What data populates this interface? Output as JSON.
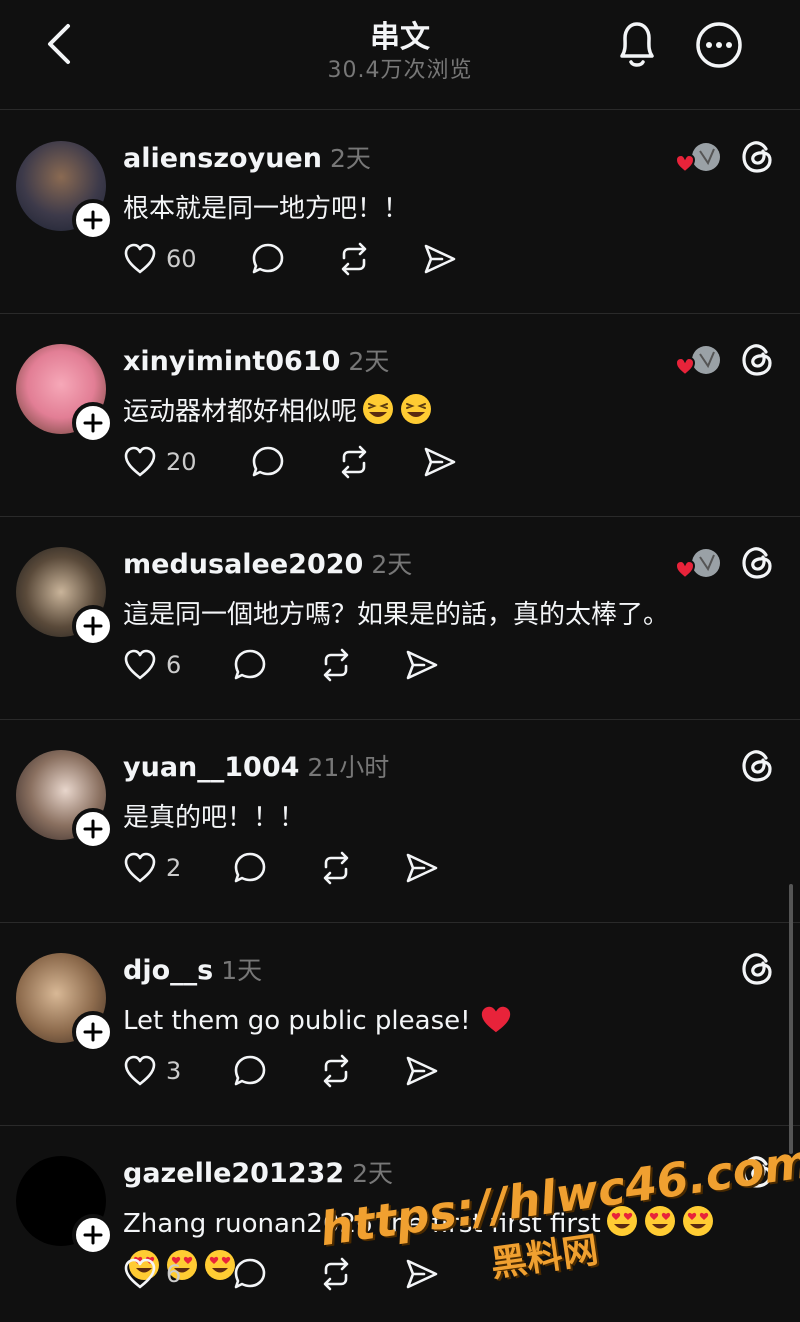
{
  "header": {
    "title": "串文",
    "subtitle": "30.4万次浏览",
    "back_icon": "chevron-left-icon",
    "bell_icon": "bell-icon",
    "more_icon": "more-icon"
  },
  "comments": [
    {
      "username": "alienszoyuen",
      "time": "2天",
      "text": "根本就是同一地方吧！！",
      "likes": "60",
      "liked_by_author": true
    },
    {
      "username": "xinyimint0610",
      "time": "2天",
      "text": "运动器材都好相似呢",
      "likes": "20",
      "liked_by_author": true
    },
    {
      "username": "medusalee2020",
      "time": "2天",
      "text": "這是同一個地方嗎？如果是的話，真的太棒了。",
      "likes": "6",
      "liked_by_author": true
    },
    {
      "username": "yuan__1004",
      "time": "21小时",
      "text": "是真的吧！！！",
      "likes": "2",
      "liked_by_author": false
    },
    {
      "username": "djo__s",
      "time": "1天",
      "text": "Let them go public please!",
      "likes": "3",
      "liked_by_author": false
    },
    {
      "username": "gazelle201232",
      "time": "2天",
      "text": "Zhang ruonan2026 the first first first",
      "likes": "6",
      "liked_by_author": false
    }
  ],
  "watermark": {
    "url": "https://hlwc46.com",
    "label": "黑料网"
  },
  "colors": {
    "background": "#101010",
    "text": "#f3f5f7",
    "muted": "#777777",
    "heart": "#ff3040",
    "watermark": "#f0a030"
  }
}
